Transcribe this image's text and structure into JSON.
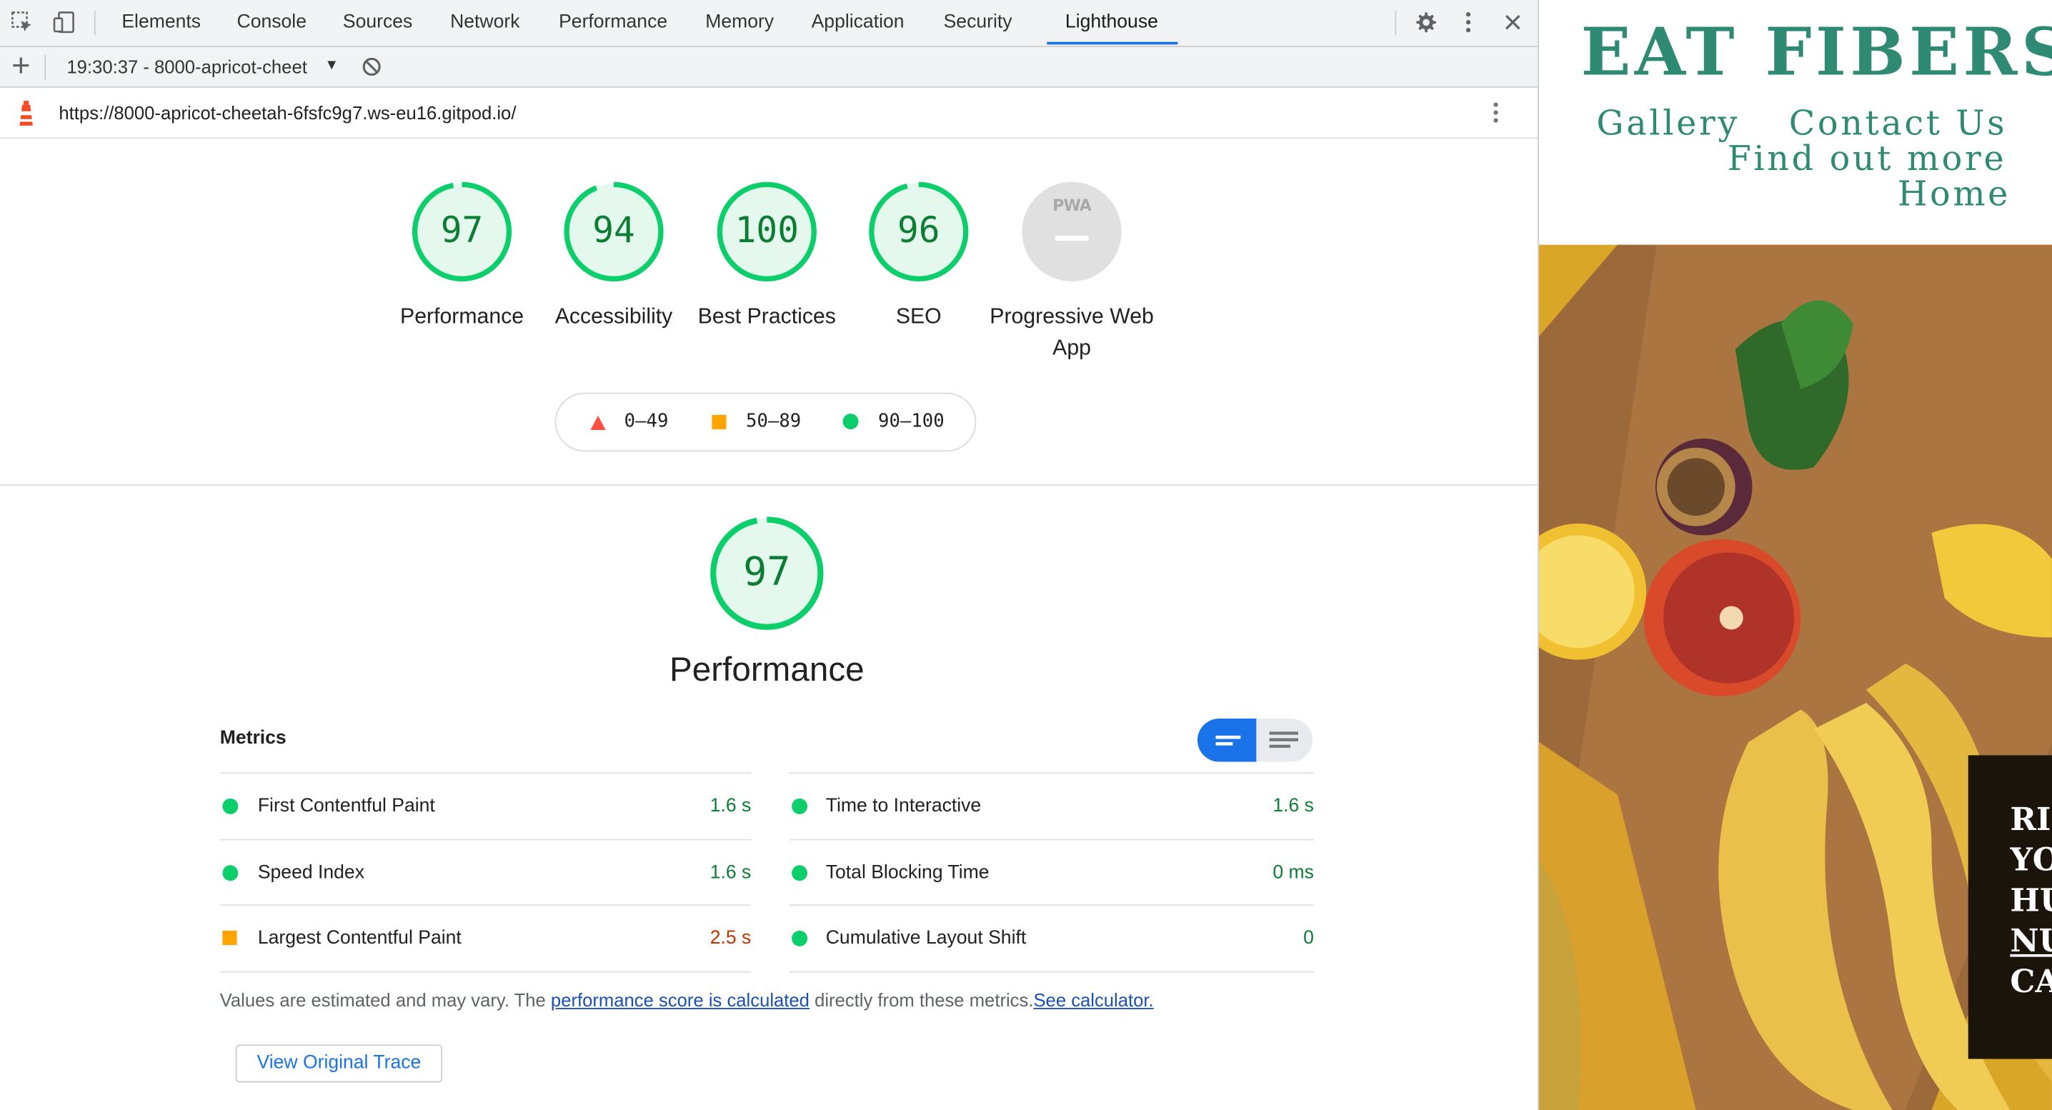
{
  "devtools": {
    "tabs": [
      "Elements",
      "Console",
      "Sources",
      "Network",
      "Performance",
      "Memory",
      "Application",
      "Security",
      "Lighthouse"
    ],
    "active_tab": "Lighthouse",
    "report_selector": "19:30:37 - 8000-apricot-cheet",
    "url": "https://8000-apricot-cheetah-6fsfc9g7.ws-eu16.gitpod.io/"
  },
  "scores": [
    {
      "value": "97",
      "label": "Performance",
      "fraction": 0.97
    },
    {
      "value": "94",
      "label": "Accessibility",
      "fraction": 0.94
    },
    {
      "value": "100",
      "label": "Best Practices",
      "fraction": 1.0
    },
    {
      "value": "96",
      "label": "SEO",
      "fraction": 0.96
    },
    {
      "value": "PWA",
      "label": "Progressive Web App",
      "fraction": 0
    }
  ],
  "legend": {
    "fail": "0–49",
    "average": "50–89",
    "pass": "90–100"
  },
  "performance": {
    "score": "97",
    "title": "Performance",
    "metrics_heading": "Metrics",
    "metrics_left": [
      {
        "name": "First Contentful Paint",
        "value": "1.6 s",
        "status": "pass"
      },
      {
        "name": "Speed Index",
        "value": "1.6 s",
        "status": "pass"
      },
      {
        "name": "Largest Contentful Paint",
        "value": "2.5 s",
        "status": "average"
      }
    ],
    "metrics_right": [
      {
        "name": "Time to Interactive",
        "value": "1.6 s",
        "status": "pass"
      },
      {
        "name": "Total Blocking Time",
        "value": "0 ms",
        "status": "pass"
      },
      {
        "name": "Cumulative Layout Shift",
        "value": "0",
        "status": "pass"
      }
    ],
    "note_prefix": "Values are estimated and may vary. The",
    "note_link": "performance score is calculated",
    "note_middle": "directly from these metrics.",
    "note_link2": "See calculator.",
    "trace_button": "View Original Trace"
  },
  "website": {
    "logo": "EAT FIBERS",
    "nav": [
      "Gallery",
      "Contact Us",
      "Find out more",
      "Home"
    ],
    "hero_text": [
      "RI",
      "YO",
      "HU",
      "NU",
      "CA"
    ]
  },
  "colors": {
    "pass": "#0cce6b",
    "average": "#ffa400",
    "fail": "#ff4e42",
    "accent": "#1a73e8",
    "brand": "#2e8a72"
  }
}
